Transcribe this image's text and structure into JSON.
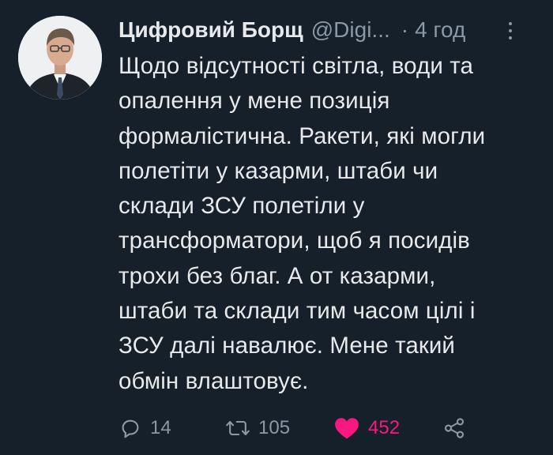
{
  "tweet": {
    "display_name": "Цифровий Борщ",
    "handle": "@Digi...",
    "separator": "·",
    "time": "4 год",
    "text": "Щодо відсутності світла, води та\nопалення у мене позиція\nформалістична. Ракети, які могли\nполетіти у казарми, штаби чи\nсклади ЗСУ полетіли у\nтрансформатори, щоб я посидів\nтрохи без благ. А от казарми,\nштаби та склади тим часом цілі і\nЗСУ далі навалює. Мене такий\nобмін влаштовує."
  },
  "actions": {
    "reply_count": "14",
    "retweet_count": "105",
    "like_count": "452"
  },
  "icons": {
    "reply": "reply-bubble-icon",
    "retweet": "retweet-arrows-icon",
    "like": "heart-filled-icon",
    "share": "share-nodes-icon",
    "more": "more-vertical-icon"
  },
  "colors": {
    "background": "#15202b",
    "text": "#e7e9ea",
    "muted": "#8b98a5",
    "like": "#f91880"
  }
}
